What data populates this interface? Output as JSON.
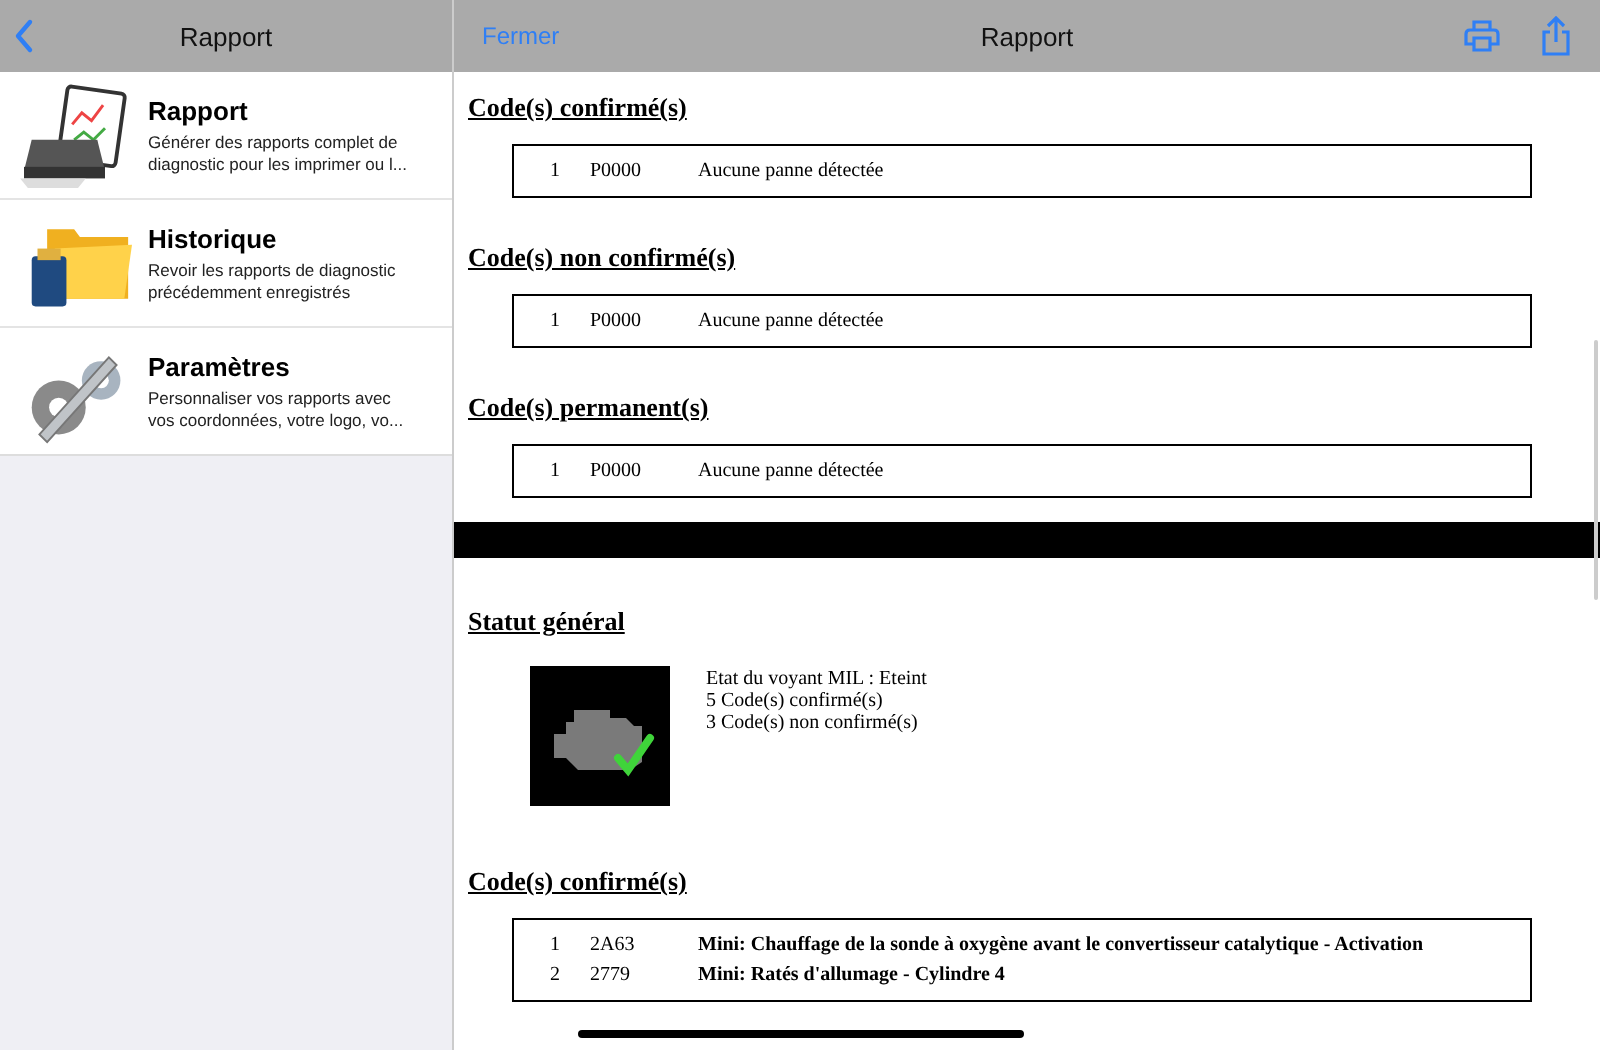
{
  "sidebar": {
    "title": "Rapport",
    "items": [
      {
        "kind": "report",
        "title": "Rapport",
        "description": "Générer des rapports complet de diagnostic pour les imprimer ou l..."
      },
      {
        "kind": "history",
        "title": "Historique",
        "description": "Revoir les rapports de diagnostic précédemment enregistrés"
      },
      {
        "kind": "settings",
        "title": "Paramètres",
        "description": "Personnaliser vos rapports avec vos coordonnées, votre logo, vo..."
      }
    ]
  },
  "report": {
    "close": "Fermer",
    "title": "Rapport",
    "sections": [
      {
        "kind": "codes",
        "heading": "Code(s) confirmé(s)",
        "bold": false,
        "rows": [
          {
            "index": "1",
            "code": "P0000",
            "description": "Aucune panne détectée"
          }
        ]
      },
      {
        "kind": "codes",
        "heading": "Code(s) non confirmé(s)",
        "bold": false,
        "rows": [
          {
            "index": "1",
            "code": "P0000",
            "description": "Aucune panne détectée"
          }
        ]
      },
      {
        "kind": "codes",
        "heading": "Code(s) permanent(s)",
        "bold": false,
        "rows": [
          {
            "index": "1",
            "code": "P0000",
            "description": "Aucune panne détectée"
          }
        ]
      },
      {
        "kind": "separator"
      },
      {
        "kind": "status",
        "heading": "Statut général",
        "lines": [
          "Etat du voyant MIL : Eteint",
          "5 Code(s) confirmé(s)",
          "3 Code(s) non confirmé(s)"
        ]
      },
      {
        "kind": "codes",
        "heading": "Code(s) confirmé(s)",
        "bold": true,
        "rows": [
          {
            "index": "1",
            "code": "2A63",
            "description": "Mini: Chauffage de la sonde à oxygène avant le convertisseur catalytique - Activation"
          },
          {
            "index": "2",
            "code": "2779",
            "description": "Mini: Ratés d'allumage - Cylindre 4"
          }
        ]
      }
    ]
  }
}
